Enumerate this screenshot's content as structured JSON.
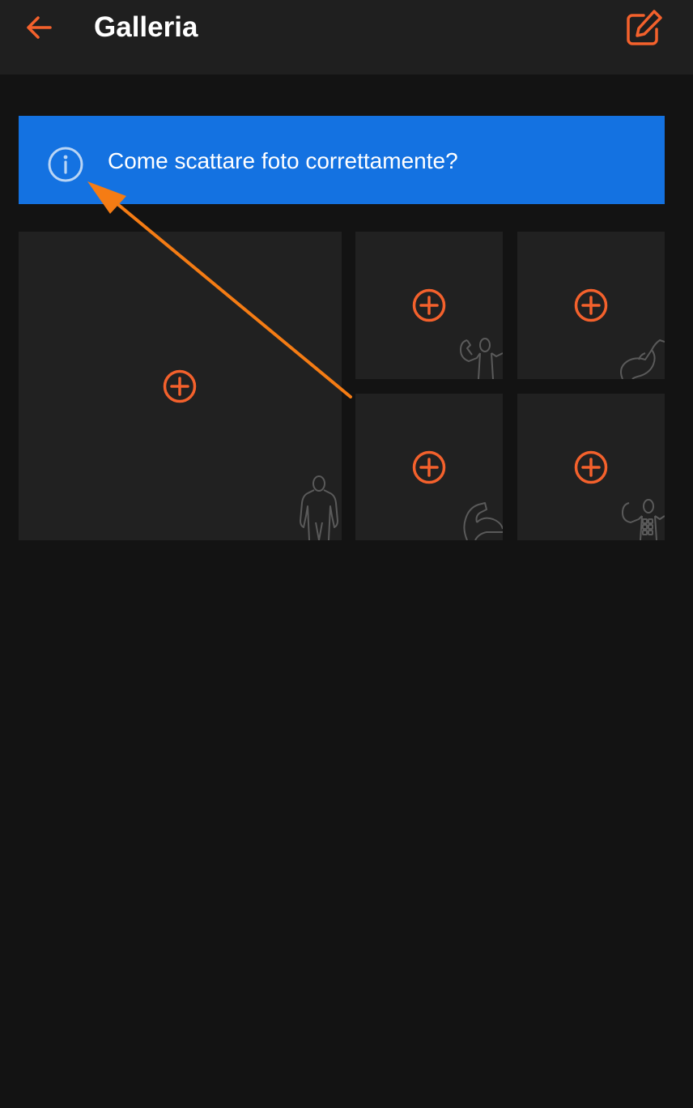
{
  "header": {
    "title": "Galleria",
    "back_icon": "arrow-left-icon",
    "edit_icon": "edit-icon"
  },
  "banner": {
    "icon": "info-icon",
    "text": "Come scattare foto correttamente?"
  },
  "gallery": {
    "tiles": [
      {
        "name": "front-full-body",
        "add_icon": "plus-circle-icon",
        "pose_icon": "body-front-icon"
      },
      {
        "name": "front-double-biceps",
        "add_icon": "plus-circle-icon",
        "pose_icon": "double-biceps-icon"
      },
      {
        "name": "arm-flex",
        "add_icon": "plus-circle-icon",
        "pose_icon": "arm-flex-icon"
      },
      {
        "name": "side-arm",
        "add_icon": "plus-circle-icon",
        "pose_icon": "arm-side-icon"
      },
      {
        "name": "abs-pose",
        "add_icon": "plus-circle-icon",
        "pose_icon": "abs-pose-icon"
      }
    ]
  },
  "colors": {
    "accent": "#f4612c",
    "background": "#131313",
    "header_bg": "#1f1f1f",
    "tile_bg": "#212121",
    "banner_bg": "#1472e1",
    "annotation_arrow": "#f57c14"
  }
}
